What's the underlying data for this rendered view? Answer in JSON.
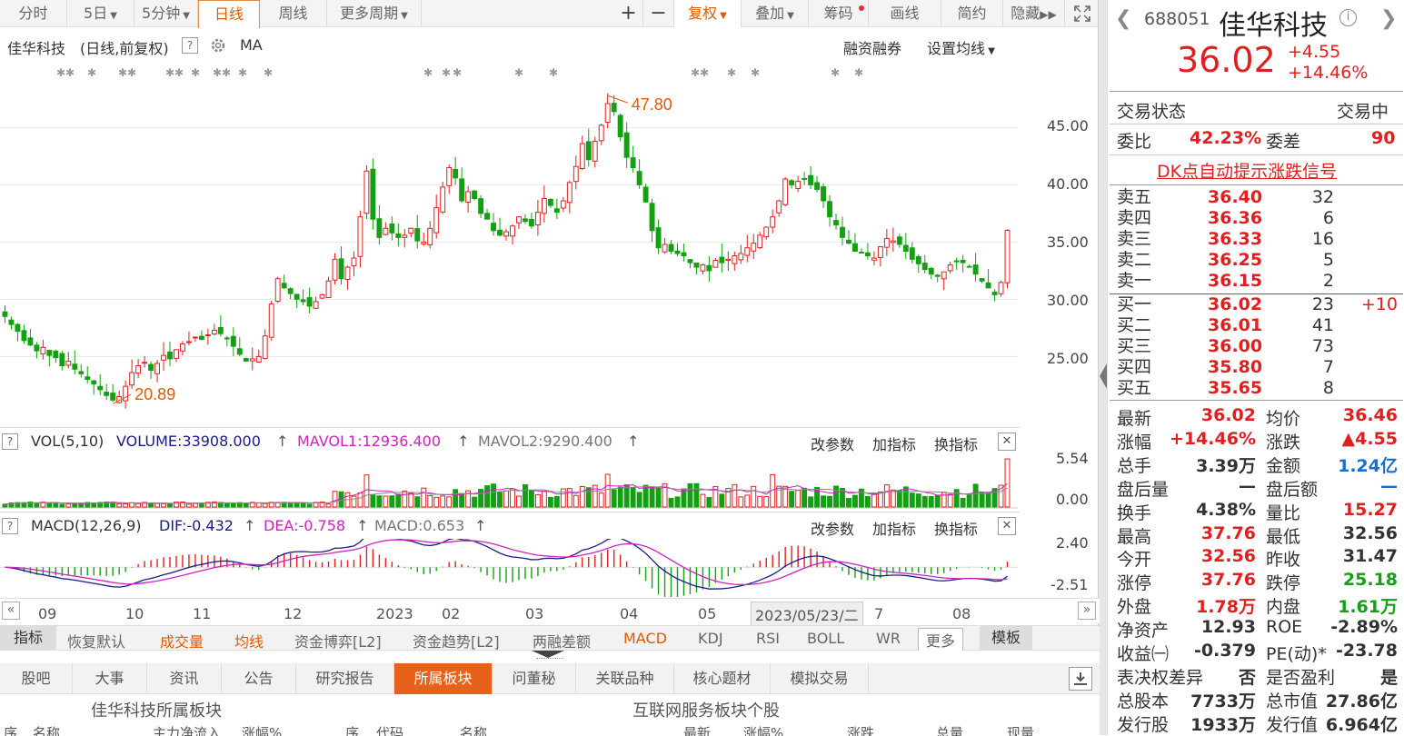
{
  "toolbar": {
    "tabs": [
      "分时",
      "5日",
      "5分钟",
      "日线",
      "周线",
      "更多周期"
    ],
    "buttons": [
      "+",
      "−",
      "复权",
      "叠加",
      "筹码",
      "画线",
      "简约",
      "隐藏"
    ]
  },
  "chart_header": {
    "name": "佳华科技",
    "mode": "(日线,前复权)",
    "help": "?",
    "ma_label": "MA",
    "margin": "融资融券",
    "set_ma": "设置均线"
  },
  "chart_data": {
    "type": "candlestick",
    "high_label": "47.80",
    "low_label": "20.89",
    "y_ticks": [
      "45.00",
      "40.00",
      "35.00",
      "30.00",
      "25.00"
    ],
    "ylim": [
      19,
      49
    ],
    "closes": [
      28.5,
      27.8,
      27.2,
      26.4,
      26.0,
      25.5,
      25.8,
      25.1,
      24.9,
      24.2,
      24.6,
      23.9,
      23.5,
      23.0,
      22.6,
      22.1,
      21.6,
      21.2,
      21.5,
      22.4,
      23.6,
      24.2,
      24.5,
      23.8,
      24.4,
      25.1,
      24.8,
      25.6,
      26.1,
      26.3,
      26.7,
      26.5,
      26.9,
      27.3,
      27.0,
      26.6,
      25.9,
      25.2,
      24.6,
      24.8,
      25.0,
      26.8,
      29.6,
      31.8,
      31.0,
      30.5,
      30.0,
      29.8,
      29.4,
      29.8,
      30.4,
      31.6,
      33.5,
      31.8,
      32.8,
      33.6,
      37.2,
      41.2,
      37.0,
      35.4,
      36.2,
      35.8,
      35.4,
      35.6,
      36.2,
      35.1,
      35.0,
      36.2,
      38.0,
      39.8,
      41.5,
      40.6,
      38.6,
      39.4,
      38.8,
      37.5,
      37.0,
      36.0,
      35.6,
      35.9,
      36.4,
      37.2,
      36.8,
      36.4,
      37.6,
      38.8,
      38.2,
      37.6,
      38.6,
      40.2,
      41.6,
      43.6,
      42.2,
      43.8,
      45.2,
      47.1,
      46.4,
      44.2,
      42.4,
      41.5,
      40.0,
      38.5,
      36.0,
      34.5,
      34.8,
      34.2,
      34.0,
      33.8,
      33.2,
      32.8,
      33.0,
      32.5,
      33.4,
      33.2,
      33.5,
      33.8,
      34.0,
      34.5,
      34.9,
      35.6,
      36.3,
      37.2,
      38.6,
      40.5,
      40.0,
      40.3,
      40.5,
      40.0,
      39.6,
      38.6,
      37.2,
      36.5,
      35.4,
      34.9,
      34.2,
      34.1,
      33.8,
      33.6,
      34.6,
      35.3,
      35.1,
      34.8,
      34.2,
      33.5,
      33.1,
      32.6,
      32.2,
      32.0,
      32.4,
      33.0,
      33.3,
      33.2,
      32.8,
      32.2,
      31.6,
      31.0,
      30.4,
      31.47,
      36.02
    ]
  },
  "vol": {
    "title": "VOL(5,10)",
    "volume": "VOLUME:33908.000",
    "mavol1": "MAVOL1:12936.400",
    "mavol2": "MAVOL2:9290.400",
    "ticks": [
      "5.54",
      "0.00"
    ]
  },
  "macd": {
    "title": "MACD(12,26,9)",
    "dif": "DIF:-0.432",
    "dea": "DEA:-0.758",
    "macd": "MACD:0.653",
    "ticks": [
      "2.40",
      "-2.51"
    ]
  },
  "ind_actions": [
    "改参数",
    "加指标",
    "换指标"
  ],
  "time_axis": [
    "09",
    "10",
    "11",
    "12",
    "2023",
    "02",
    "03",
    "04",
    "05",
    "2023/05/23/二",
    "7",
    "08"
  ],
  "ind_tabs": [
    "指标",
    "恢复默认",
    "成交量",
    "均线",
    "资金博弈[L2]",
    "资金趋势[L2]",
    "两融差额",
    "MACD",
    "KDJ",
    "RSI",
    "BOLL",
    "WR",
    "更多",
    "模板"
  ],
  "bottom_tabs": [
    "股吧",
    "大事",
    "资讯",
    "公告",
    "研究报告",
    "所属板块",
    "问董秘",
    "关联品种",
    "核心题材",
    "模拟交易"
  ],
  "section_heads": {
    "left": "佳华科技所属板块",
    "right": "互联网服务板块个股",
    "cols": [
      "序",
      "名称",
      "主力净流入",
      "涨幅%",
      "序",
      "代码",
      "名称",
      "最新",
      "涨幅%",
      "涨跌",
      "总量",
      "现量"
    ]
  },
  "quote": {
    "code": "688051",
    "name": "佳华科技",
    "price": "36.02",
    "change": "+4.55",
    "pct": "+14.46%",
    "status_label": "交易状态",
    "status": "交易中",
    "wb_label": "委比",
    "wb": "42.23%",
    "wc_label": "委差",
    "wc": "90",
    "dk": "DK点自动提示涨跌信号"
  },
  "sells": [
    [
      "卖五",
      "36.40",
      "32"
    ],
    [
      "卖四",
      "36.36",
      "6"
    ],
    [
      "卖三",
      "36.33",
      "16"
    ],
    [
      "卖二",
      "36.25",
      "5"
    ],
    [
      "卖一",
      "36.15",
      "2"
    ]
  ],
  "buys": [
    [
      "买一",
      "36.02",
      "23",
      "+10"
    ],
    [
      "买二",
      "36.01",
      "41",
      ""
    ],
    [
      "买三",
      "36.00",
      "73",
      ""
    ],
    [
      "买四",
      "35.80",
      "7",
      ""
    ],
    [
      "买五",
      "35.65",
      "8",
      ""
    ]
  ],
  "stats": [
    [
      "最新",
      "36.02",
      "均价",
      "36.46"
    ],
    [
      "涨幅",
      "+14.46%",
      "涨跌",
      "▲4.55"
    ],
    [
      "总手",
      "3.39万",
      "金额",
      "1.24亿"
    ],
    [
      "盘后量",
      "—",
      "盘后额",
      "—"
    ],
    [
      "换手",
      "4.38%",
      "量比",
      "15.27"
    ],
    [
      "最高",
      "37.76",
      "最低",
      "32.56"
    ],
    [
      "今开",
      "32.56",
      "昨收",
      "31.47"
    ],
    [
      "涨停",
      "37.76",
      "跌停",
      "25.18"
    ],
    [
      "外盘",
      "1.78万",
      "内盘",
      "1.61万"
    ],
    [
      "净资产",
      "12.93",
      "ROE",
      "-2.89%"
    ],
    [
      "收益㈠",
      "-0.379",
      "PE(动)*",
      "-23.78"
    ],
    [
      "表决权差异",
      "否",
      "是否盈利",
      "是"
    ],
    [
      "总股本",
      "7733万",
      "总市值",
      "27.86亿"
    ],
    [
      "发行股",
      "1933万",
      "发行值",
      "6.964亿"
    ]
  ],
  "colors": {
    "up": "#e02020",
    "down": "#13a013",
    "accent": "#e8611a"
  }
}
